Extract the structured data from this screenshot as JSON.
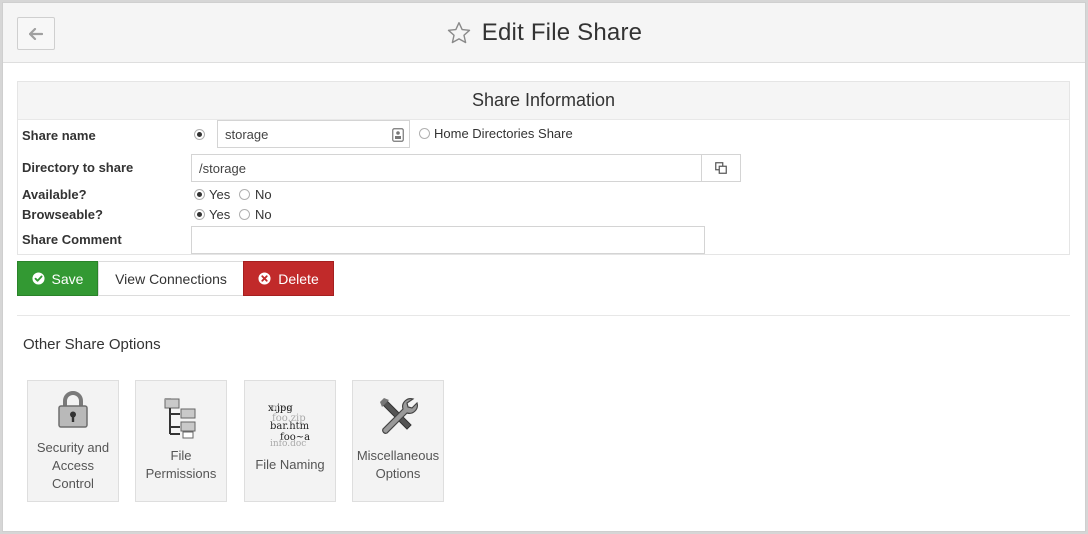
{
  "header": {
    "title": "Edit File Share"
  },
  "share_info": {
    "heading": "Share Information",
    "share_name": {
      "label": "Share name",
      "value": "storage",
      "home_option": "Home Directories Share"
    },
    "directory": {
      "label": "Directory to share",
      "value": "/storage"
    },
    "available": {
      "label": "Available?",
      "yes": "Yes",
      "no": "No",
      "selected": "Yes"
    },
    "browseable": {
      "label": "Browseable?",
      "yes": "Yes",
      "no": "No",
      "selected": "Yes"
    },
    "comment": {
      "label": "Share Comment",
      "value": ""
    }
  },
  "actions": {
    "save": "Save",
    "view_connections": "View Connections",
    "delete": "Delete"
  },
  "other_options": {
    "title": "Other Share Options",
    "tiles": [
      {
        "label": "Security and\nAccess\nControl",
        "icon": "padlock-icon"
      },
      {
        "label": "File\nPermissions",
        "icon": "folder-tree-icon"
      },
      {
        "label": "File Naming",
        "icon": "file-names-icon"
      },
      {
        "label": "Miscellaneous\nOptions",
        "icon": "tools-icon"
      }
    ]
  },
  "colors": {
    "save": "#339933",
    "delete": "#c12a2a",
    "header_bg": "#f5f5f5"
  }
}
